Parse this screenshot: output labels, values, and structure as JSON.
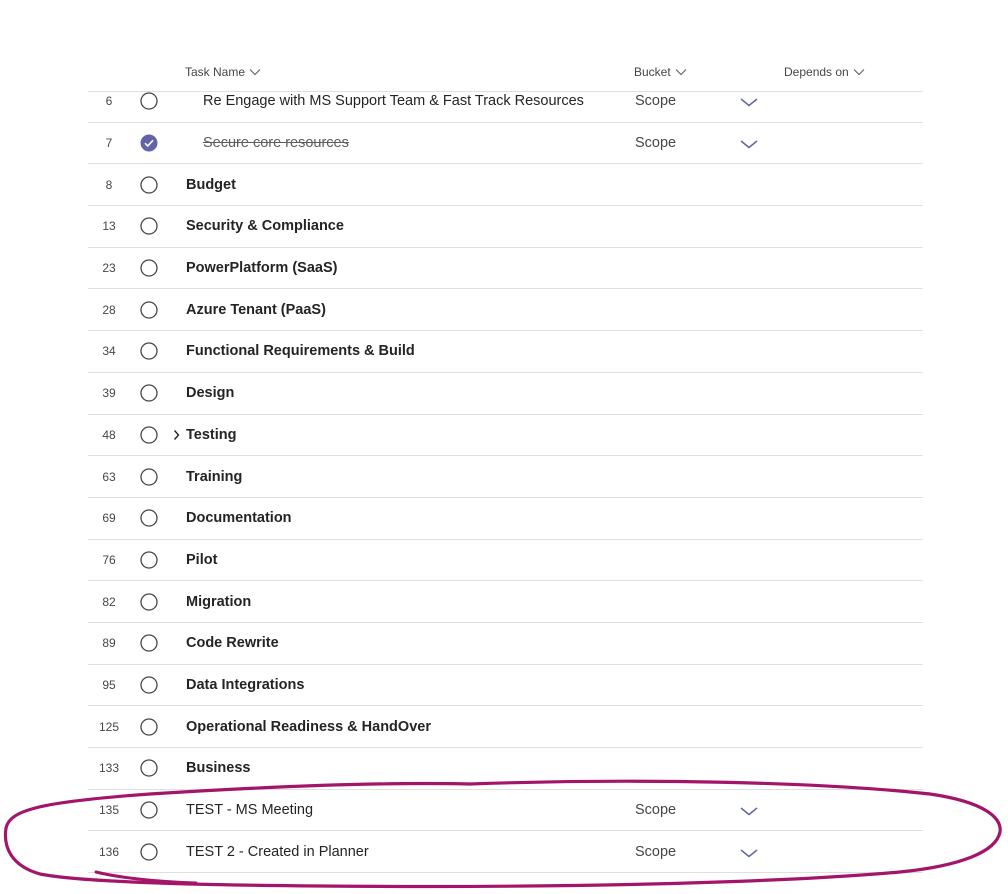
{
  "columns": {
    "task_name": "Task Name",
    "bucket": "Bucket",
    "depends_on": "Depends on"
  },
  "rows": [
    {
      "num": "6",
      "name": "Re Engage with MS Support Team & Fast Track Resources",
      "bucket": "Scope",
      "completed": false
    },
    {
      "num": "7",
      "name": "Secure core resources",
      "bucket": "Scope",
      "completed": true
    },
    {
      "num": "8",
      "name": "Budget",
      "completed": false
    },
    {
      "num": "13",
      "name": "Security & Compliance",
      "completed": false
    },
    {
      "num": "23",
      "name": "PowerPlatform (SaaS)",
      "completed": false
    },
    {
      "num": "28",
      "name": "Azure Tenant (PaaS)",
      "completed": false
    },
    {
      "num": "34",
      "name": "Functional Requirements & Build",
      "completed": false
    },
    {
      "num": "39",
      "name": "Design",
      "completed": false
    },
    {
      "num": "48",
      "name": "Testing",
      "completed": false
    },
    {
      "num": "63",
      "name": "Training",
      "completed": false
    },
    {
      "num": "69",
      "name": "Documentation",
      "completed": false
    },
    {
      "num": "76",
      "name": "Pilot",
      "completed": false
    },
    {
      "num": "82",
      "name": "Migration",
      "completed": false
    },
    {
      "num": "89",
      "name": "Code Rewrite",
      "completed": false
    },
    {
      "num": "95",
      "name": "Data Integrations",
      "completed": false
    },
    {
      "num": "125",
      "name": "Operational Readiness & HandOver",
      "completed": false
    },
    {
      "num": "133",
      "name": "Business",
      "completed": false
    },
    {
      "num": "135",
      "name": "TEST - MS Meeting",
      "bucket": "Scope",
      "completed": false
    },
    {
      "num": "136",
      "name": "TEST 2 - Created in Planner",
      "bucket": "Scope",
      "completed": false
    }
  ],
  "colors": {
    "accent": "#6264a7",
    "annotation": "#a3146b",
    "divider": "#e1dfdd"
  }
}
